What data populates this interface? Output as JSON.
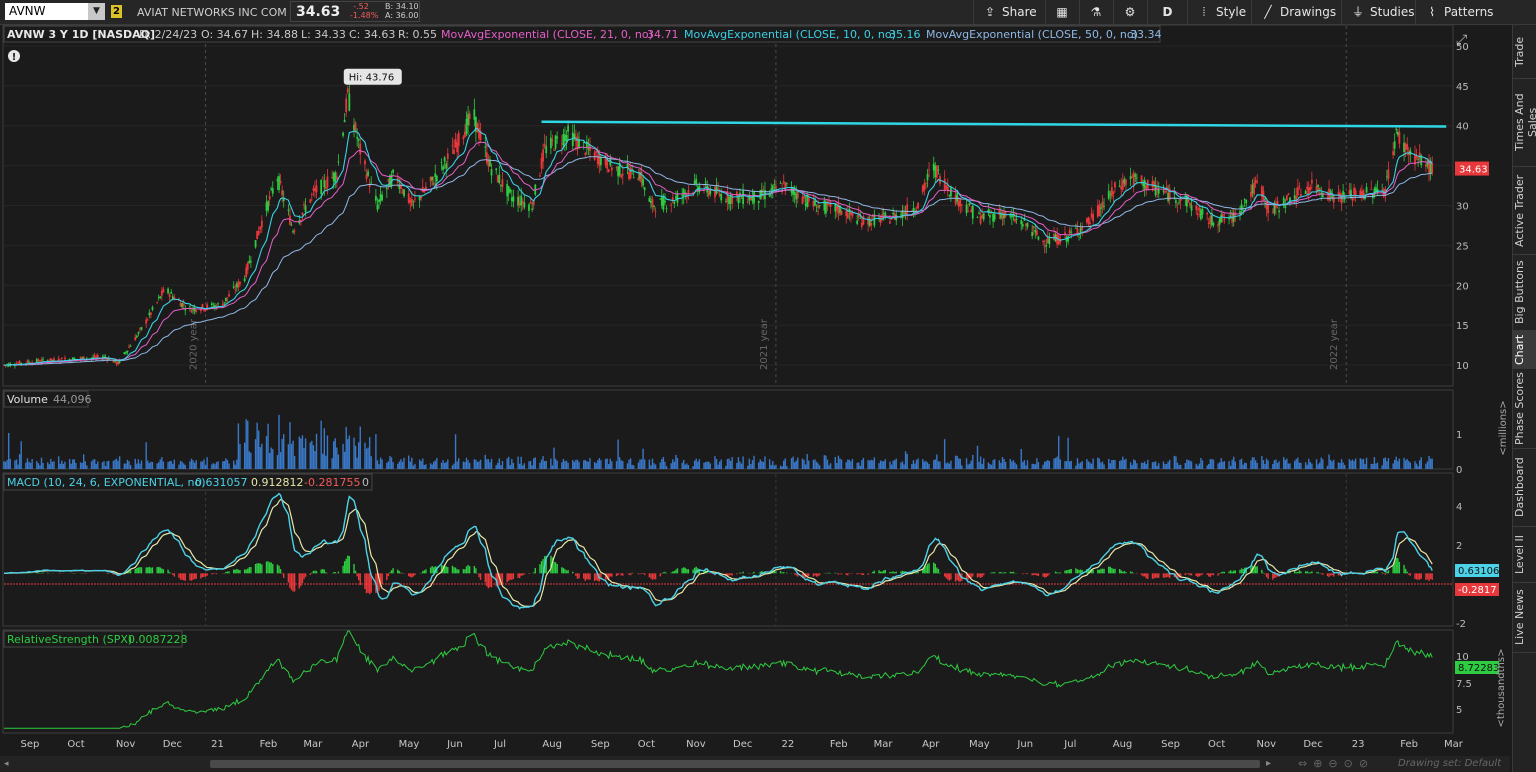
{
  "toolbar": {
    "symbol": "AVNW",
    "link_badge": "2",
    "company": "AVIAT NETWORKS INC COM",
    "last": "34.63",
    "change": "-.52",
    "change_pct": "-1.48%",
    "bid": "B: 34.10",
    "ask": "A: 36.00",
    "buttons": {
      "share": "Share",
      "period": "D",
      "style": "Style",
      "drawings": "Drawings",
      "studies": "Studies",
      "patterns": "Patterns"
    }
  },
  "header": {
    "title": "AVNW 3 Y 1D [NASDAQ]",
    "date": "D: 2/24/23",
    "open": "O: 34.67",
    "high": "H: 34.88",
    "low": "L: 34.33",
    "close": "C: 34.63",
    "range": "R: 0.55",
    "ema21_label": "MovAvgExponential (CLOSE, 21, 0, no)",
    "ema21_value": "34.71",
    "ema10_label": "MovAvgExponential (CLOSE, 10, 0, no)",
    "ema10_value": "35.16",
    "ema50_label": "MovAvgExponential (CLOSE, 50, 0, no)",
    "ema50_value": "33.34"
  },
  "price_annotation": {
    "hi_label": "Hi: 43.76"
  },
  "price_axis": {
    "ticks": [
      "50",
      "45",
      "40",
      "35",
      "30",
      "25",
      "20",
      "15",
      "10"
    ],
    "last_price": "34.63"
  },
  "year_markers": [
    "2020 year",
    "2021 year",
    "2022 year"
  ],
  "volume_panel": {
    "label": "Volume",
    "value": "44,096",
    "ticks": [
      "1",
      "0"
    ],
    "unit": "<millions>"
  },
  "macd_panel": {
    "label": "MACD (10, 24, 6, EXPONENTIAL, no)",
    "value": "0.631057",
    "avg": "0.912812",
    "diff": "-0.281755",
    "zero": "0",
    "ticks": [
      "4",
      "2",
      "-2"
    ],
    "value_tag": "0.63106",
    "diff_tag": "-0.2817"
  },
  "rs_panel": {
    "label": "RelativeStrength (SPX)",
    "value": "0.0087228",
    "ticks": [
      "10",
      "7.5",
      "5"
    ],
    "tag": "8.72283",
    "unit": "<thousandths>"
  },
  "x_axis": [
    "Sep",
    "Oct",
    "Nov",
    "Dec",
    "21",
    "Feb",
    "Mar",
    "Apr",
    "May",
    "Jun",
    "Jul",
    "Aug",
    "Sep",
    "Oct",
    "Nov",
    "Dec",
    "22",
    "Feb",
    "Mar",
    "Apr",
    "May",
    "Jun",
    "Jul",
    "Aug",
    "Sep",
    "Oct",
    "Nov",
    "Dec",
    "23",
    "Feb",
    "Mar"
  ],
  "right_tabs": [
    "Trade",
    "Times And Sales",
    "Active Trader",
    "Big Buttons",
    "Chart",
    "Phase Scores",
    "Dashboard",
    "Level II",
    "Live News"
  ],
  "status": {
    "drawing_set": "Drawing set: Default"
  },
  "colors": {
    "up": "#2ecc40",
    "down": "#e8383b",
    "ema21": "#e55fc8",
    "ema10": "#3ad0e6",
    "ema50": "#8fb8e6",
    "trendline": "#2fd6e6",
    "macd": "#4cd2e8",
    "macd_avg": "#e8e6a8",
    "bg": "#1b1b1b",
    "grid": "#333333"
  },
  "chart_data": {
    "type": "candlestick",
    "close_path": [
      [
        "2020-08-24",
        10.0
      ],
      [
        "2020-09-15",
        10.5
      ],
      [
        "2020-10-10",
        10.8
      ],
      [
        "2020-10-28",
        11.0
      ],
      [
        "2020-11-05",
        10.2
      ],
      [
        "2020-11-20",
        14.5
      ],
      [
        "2020-12-05",
        19.5
      ],
      [
        "2020-12-20",
        17.0
      ],
      [
        "2021-01-10",
        17.5
      ],
      [
        "2021-01-25",
        21.0
      ],
      [
        "2021-02-05",
        28.0
      ],
      [
        "2021-02-15",
        33.5
      ],
      [
        "2021-02-25",
        27.0
      ],
      [
        "2021-03-10",
        31.5
      ],
      [
        "2021-03-25",
        34.0
      ],
      [
        "2021-04-01",
        43.76
      ],
      [
        "2021-04-10",
        36.0
      ],
      [
        "2021-04-20",
        30.0
      ],
      [
        "2021-05-01",
        34.0
      ],
      [
        "2021-05-12",
        30.0
      ],
      [
        "2021-05-25",
        33.0
      ],
      [
        "2021-06-08",
        37.0
      ],
      [
        "2021-06-20",
        41.5
      ],
      [
        "2021-07-01",
        35.0
      ],
      [
        "2021-07-15",
        31.0
      ],
      [
        "2021-07-28",
        30.0
      ],
      [
        "2021-08-05",
        37.0
      ],
      [
        "2021-08-20",
        39.0
      ],
      [
        "2021-09-01",
        37.0
      ],
      [
        "2021-09-20",
        34.5
      ],
      [
        "2021-10-05",
        34.0
      ],
      [
        "2021-10-12",
        30.0
      ],
      [
        "2021-10-25",
        30.5
      ],
      [
        "2021-11-10",
        32.5
      ],
      [
        "2021-12-01",
        31.0
      ],
      [
        "2021-12-20",
        31.0
      ],
      [
        "2022-01-05",
        32.5
      ],
      [
        "2022-01-25",
        30.0
      ],
      [
        "2022-02-10",
        29.5
      ],
      [
        "2022-02-25",
        28.0
      ],
      [
        "2022-03-15",
        28.5
      ],
      [
        "2022-04-01",
        30.0
      ],
      [
        "2022-04-10",
        35.0
      ],
      [
        "2022-04-25",
        31.0
      ],
      [
        "2022-05-10",
        28.5
      ],
      [
        "2022-05-25",
        29.0
      ],
      [
        "2022-06-10",
        27.5
      ],
      [
        "2022-06-20",
        25.5
      ],
      [
        "2022-07-05",
        26.0
      ],
      [
        "2022-07-20",
        28.0
      ],
      [
        "2022-08-05",
        32.0
      ],
      [
        "2022-08-15",
        33.5
      ],
      [
        "2022-09-01",
        32.0
      ],
      [
        "2022-09-20",
        30.5
      ],
      [
        "2022-10-05",
        28.0
      ],
      [
        "2022-10-20",
        28.5
      ],
      [
        "2022-11-05",
        33.0
      ],
      [
        "2022-11-12",
        29.0
      ],
      [
        "2022-11-25",
        31.0
      ],
      [
        "2022-12-10",
        32.5
      ],
      [
        "2022-12-25",
        31.0
      ],
      [
        "2023-01-10",
        31.5
      ],
      [
        "2023-01-25",
        32.0
      ],
      [
        "2023-02-01",
        39.0
      ],
      [
        "2023-02-10",
        36.5
      ],
      [
        "2023-02-24",
        34.63
      ]
    ],
    "trendline": [
      [
        "2021-08-03",
        40.5
      ],
      [
        "2023-03-05",
        39.9
      ]
    ],
    "high_marker": {
      "date": "2021-04-01",
      "value": 43.76
    },
    "ylim": [
      7.5,
      52.5
    ],
    "volume_ylim": [
      0,
      1.6
    ],
    "macd_ylim": [
      -2.6,
      5
    ],
    "rs_ylim": [
      2.5,
      10.5
    ]
  }
}
